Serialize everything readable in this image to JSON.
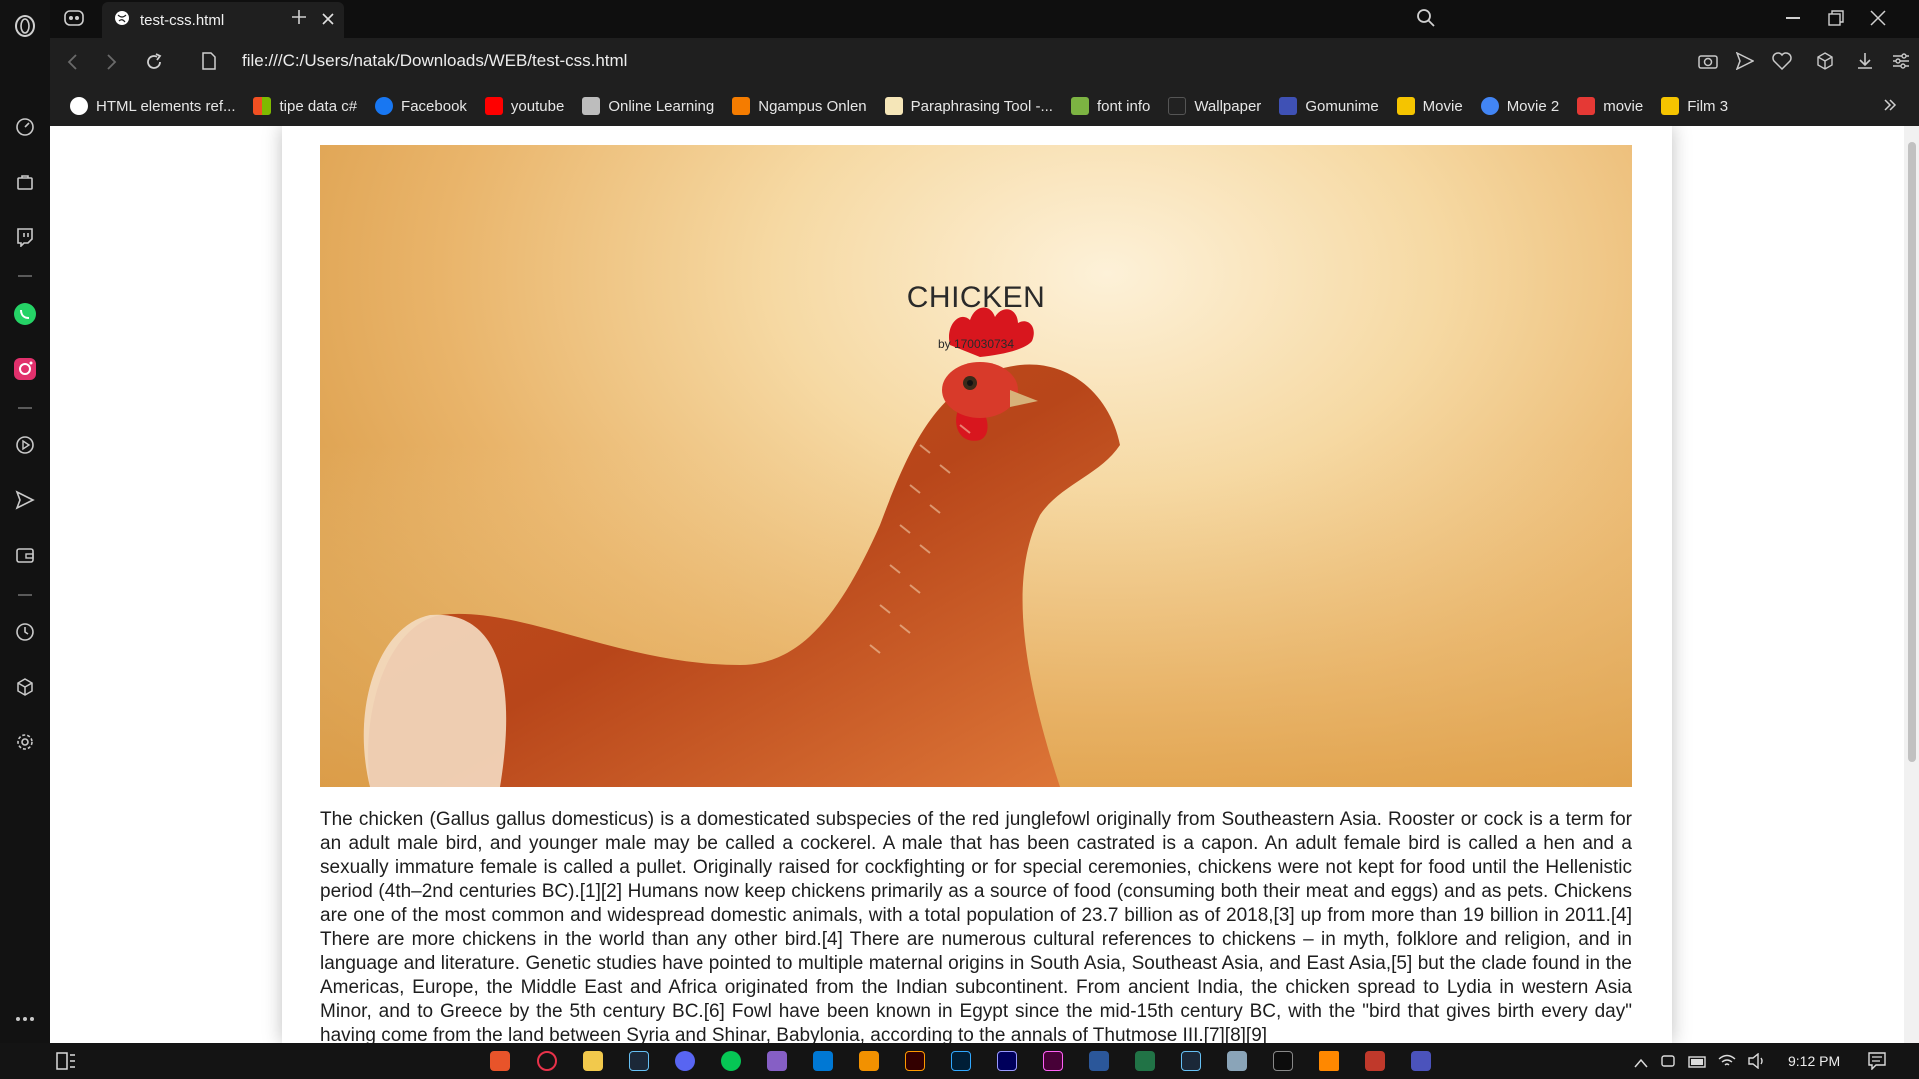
{
  "browser": {
    "tab_title": "test-css.html",
    "url": "file:///C:/Users/natak/Downloads/WEB/test-css.html"
  },
  "bookmarks": [
    {
      "label": "HTML elements ref...",
      "color": "#ffffff"
    },
    {
      "label": "tipe data c#",
      "color": "#f25022"
    },
    {
      "label": "Facebook",
      "color": "#1877f2"
    },
    {
      "label": "youtube",
      "color": "#ff0000"
    },
    {
      "label": "Online Learning",
      "color": "#bdbdbd"
    },
    {
      "label": "Ngampus Onlen",
      "color": "#f57c00"
    },
    {
      "label": "Paraphrasing Tool -...",
      "color": "#f5e6b8"
    },
    {
      "label": "font info",
      "color": "#7cb342"
    },
    {
      "label": "Wallpaper",
      "color": "#222222"
    },
    {
      "label": "Gomunime",
      "color": "#3f51b5"
    },
    {
      "label": "Movie",
      "color": "#f5c400"
    },
    {
      "label": "Movie 2",
      "color": "#4285f4"
    },
    {
      "label": "movie",
      "color": "#e53935"
    },
    {
      "label": "Film 3",
      "color": "#f5c400"
    }
  ],
  "page": {
    "title": "CHICKEN",
    "byline": "by 170030734",
    "body": "The chicken (Gallus gallus domesticus) is a domesticated subspecies of the red junglefowl originally from Southeastern Asia. Rooster or cock is a term for an adult male bird, and younger male may be called a cockerel. A male that has been castrated is a capon. An adult female bird is called a hen and a sexually immature female is called a pullet. Originally raised for cockfighting or for special ceremonies, chickens were not kept for food until the Hellenistic period (4th–2nd centuries BC).[1][2] Humans now keep chickens primarily as a source of food (consuming both their meat and eggs) and as pets. Chickens are one of the most common and widespread domestic animals, with a total population of 23.7 billion as of 2018,[3] up from more than 19 billion in 2011.[4] There are more chickens in the world than any other bird.[4] There are numerous cultural references to chickens – in myth, folklore and religion, and in language and literature. Genetic studies have pointed to multiple maternal origins in South Asia, Southeast Asia, and East Asia,[5] but the clade found in the Americas, Europe, the Middle East and Africa originated from the Indian subcontinent. From ancient India, the chicken spread to Lydia in western Asia Minor, and to Greece by the 5th century BC.[6] Fowl have been known in Egypt since the mid-15th century BC, with the \"bird that gives birth every day\" having come from the land between Syria and Shinar, Babylonia, according to the annals of Thutmose III.[7][8][9]"
  },
  "taskbar": {
    "clock": "9:12 PM"
  },
  "colors": {
    "chrome_dark": "#1f1f1f",
    "sidebar": "#121212",
    "whatsapp": "#25d366",
    "instagram": "#e1306c"
  }
}
